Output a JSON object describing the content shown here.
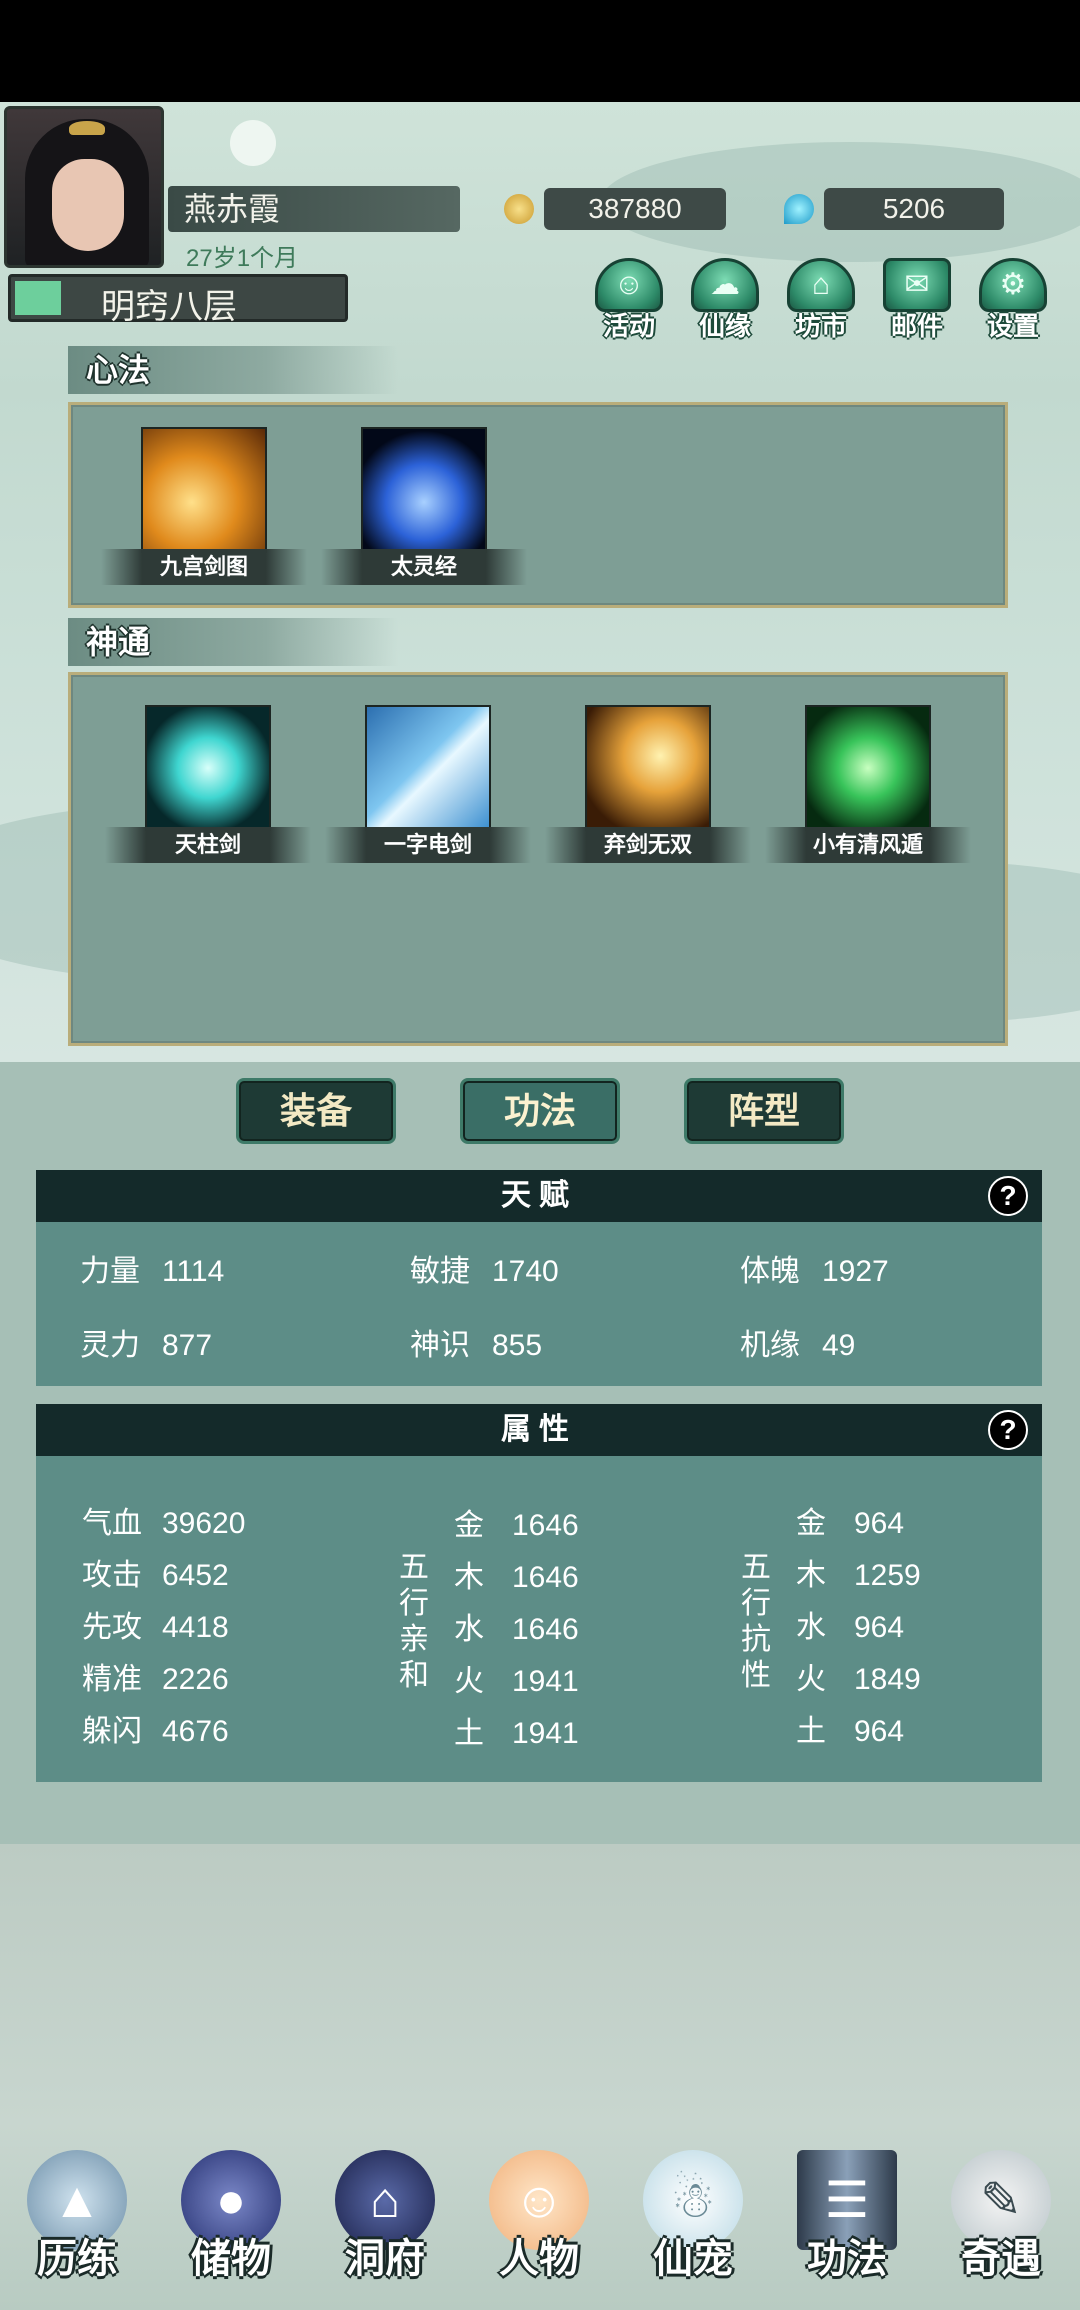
{
  "player": {
    "name": "燕赤霞",
    "age": "27岁1个月",
    "realm": "明窍八层",
    "realm_progress": 0.14
  },
  "currency": {
    "coins": "387880",
    "gems": "5206",
    "coin_icon": "gold-coin-icon",
    "gem_icon": "blue-gem-icon"
  },
  "top_menu": [
    {
      "label": "活动",
      "icon": "activity-icon"
    },
    {
      "label": "仙缘",
      "icon": "cloud-fate-icon"
    },
    {
      "label": "坊市",
      "icon": "market-icon"
    },
    {
      "label": "邮件",
      "icon": "mail-icon"
    },
    {
      "label": "设置",
      "icon": "gear-icon"
    }
  ],
  "xinfa": {
    "title": "心法",
    "skills": [
      {
        "name": "九宫剑图",
        "color": "#e08a1c"
      },
      {
        "name": "太灵经",
        "color": "#2c62d8"
      }
    ]
  },
  "shentong": {
    "title": "神通",
    "skills": [
      {
        "name": "天柱剑",
        "color": "#3fd6d0"
      },
      {
        "name": "一字电剑",
        "color": "#7ec6f0"
      },
      {
        "name": "弃剑无双",
        "color": "#e6a23a"
      },
      {
        "name": "小有清风遁",
        "color": "#38c45a"
      }
    ]
  },
  "tabs": {
    "equip": "装备",
    "gongfa": "功法",
    "formation": "阵型",
    "active": "gongfa"
  },
  "talent": {
    "title": "天赋",
    "help": "?",
    "rows": [
      [
        {
          "k": "力量",
          "v": "1114"
        },
        {
          "k": "敏捷",
          "v": "1740"
        },
        {
          "k": "体魄",
          "v": "1927"
        }
      ],
      [
        {
          "k": "灵力",
          "v": "877"
        },
        {
          "k": "神识",
          "v": "855"
        },
        {
          "k": "机缘",
          "v": "49"
        }
      ]
    ]
  },
  "attributes": {
    "title": "属性",
    "help": "?",
    "base": [
      {
        "k": "气血",
        "v": "39620"
      },
      {
        "k": "攻击",
        "v": "6452"
      },
      {
        "k": "先攻",
        "v": "4418"
      },
      {
        "k": "精准",
        "v": "2226"
      },
      {
        "k": "躲闪",
        "v": "4676"
      }
    ],
    "affinity_label": [
      "五",
      "行",
      "亲",
      "和"
    ],
    "affinity": [
      {
        "k": "金",
        "v": "1646"
      },
      {
        "k": "木",
        "v": "1646"
      },
      {
        "k": "水",
        "v": "1646"
      },
      {
        "k": "火",
        "v": "1941"
      },
      {
        "k": "土",
        "v": "1941"
      }
    ],
    "resist_label": [
      "五",
      "行",
      "抗",
      "性"
    ],
    "resist": [
      {
        "k": "金",
        "v": "964"
      },
      {
        "k": "木",
        "v": "1259"
      },
      {
        "k": "水",
        "v": "964"
      },
      {
        "k": "火",
        "v": "1849"
      },
      {
        "k": "土",
        "v": "964"
      }
    ]
  },
  "bottom_nav": [
    {
      "label": "历练",
      "icon": "mountain-icon"
    },
    {
      "label": "储物",
      "icon": "pouch-icon"
    },
    {
      "label": "洞府",
      "icon": "pagoda-icon"
    },
    {
      "label": "人物",
      "icon": "character-icon"
    },
    {
      "label": "仙宠",
      "icon": "ghost-pet-icon"
    },
    {
      "label": "功法",
      "icon": "scroll-icon"
    },
    {
      "label": "奇遇",
      "icon": "brush-icon"
    }
  ]
}
